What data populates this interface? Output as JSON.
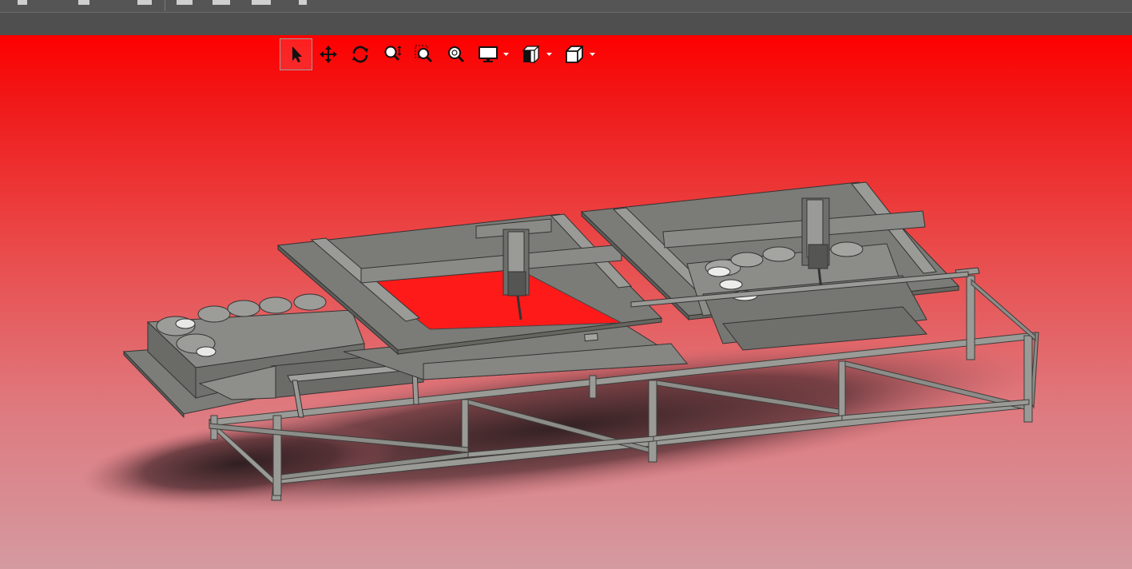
{
  "window": {
    "top_bar_color": "#555555",
    "second_bar_color": "#4f4f4f"
  },
  "viewport": {
    "background_top": "#ff0000",
    "background_bottom": "#d49aa0"
  },
  "heads_up_toolbar": {
    "tools": [
      {
        "id": "select",
        "icon": "arrow-pointer-icon",
        "active": true
      },
      {
        "id": "pan",
        "icon": "move-arrows-icon",
        "active": false
      },
      {
        "id": "rotate",
        "icon": "rotate-icon",
        "active": false
      },
      {
        "id": "zoom-in-out",
        "icon": "zoom-in-out-icon",
        "active": false
      },
      {
        "id": "zoom-to-area",
        "icon": "zoom-area-icon",
        "active": false
      },
      {
        "id": "zoom-to-fit",
        "icon": "zoom-fit-icon",
        "active": false
      },
      {
        "id": "display-style",
        "icon": "monitor-icon",
        "has_dropdown": true
      },
      {
        "id": "section-view",
        "icon": "section-view-icon",
        "has_dropdown": true
      },
      {
        "id": "view-orientation",
        "icon": "cube-icon",
        "has_dropdown": true
      }
    ]
  },
  "model": {
    "description_color": "#7a7a76",
    "frame_color": "#8c8c88"
  }
}
